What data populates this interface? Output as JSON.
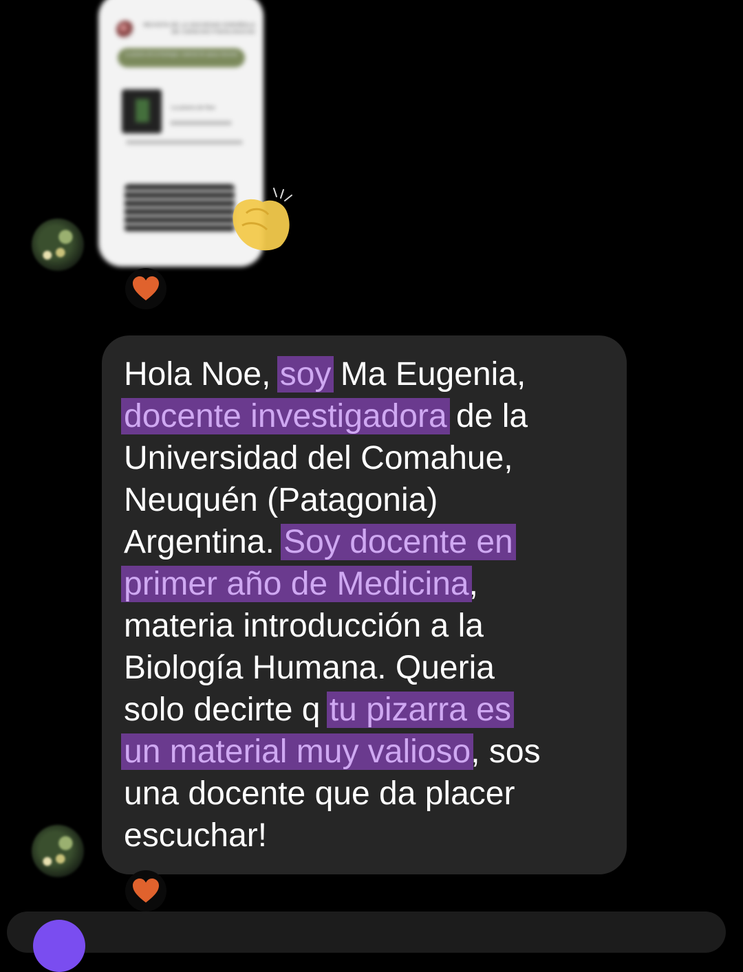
{
  "shared_post": {
    "header_title": "REVISTA DE LA SOCIEDAD ESPAÑOLA DE CIENCIAS FISIOLÓGICAS",
    "pill_text": "La pizarra de la fisiología: material de apoyo docente",
    "caption": "La pizarra de Noe"
  },
  "reactions": {
    "clap_icon": "clapping-hands-emoji",
    "heart_icon": "heart-emoji",
    "heart_color": "#e0622d"
  },
  "message": {
    "seg1": "Hola Noe, ",
    "seg2_hl": "soy",
    "seg3": " Ma Eugenia,\n",
    "seg4_hl": "docente investigadora",
    "seg5": " de la\nUniversidad del Comahue,\nNeuquén (Patagonia)\nArgentina. ",
    "seg6_hl": "Soy docente en\nprimer año de Medicina",
    "seg7": ",\nmateria introducción a la\nBiología Humana. Queria\nsolo decirte q ",
    "seg8_hl": "tu pizarra es\nun material muy valioso",
    "seg9": ", sos\nuna docente que da placer\nescuchar!"
  },
  "colors": {
    "background": "#000000",
    "bubble": "#262626",
    "highlight_bg": "#6a3a8e",
    "highlight_text": "#cfa8f2",
    "composer_accent": "#7a4df0"
  }
}
